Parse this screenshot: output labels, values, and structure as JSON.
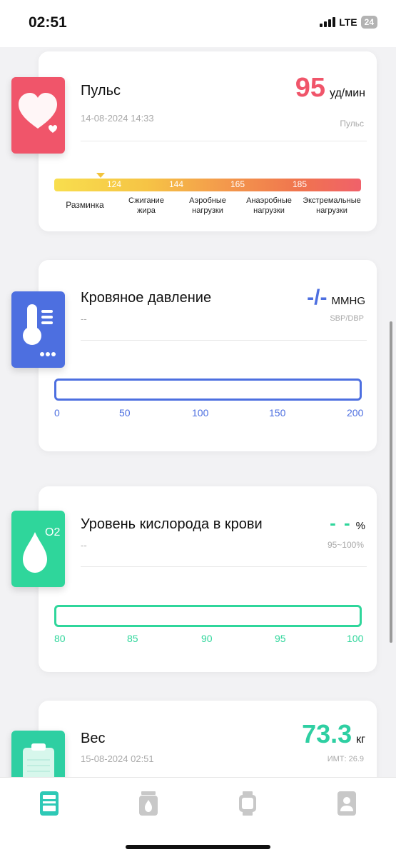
{
  "status": {
    "time": "02:51",
    "network": "LTE",
    "battery": "24"
  },
  "pulse": {
    "title": "Пульс",
    "date": "14-08-2024 14:33",
    "value": "95",
    "unit": "уд/мин",
    "sub": "Пульс",
    "color": "#f0556a",
    "ticks": [
      "124",
      "144",
      "165",
      "185"
    ],
    "zones": [
      "Разминка",
      "Сжигание\nжира",
      "Аэробные\nнагрузки",
      "Анаэробные\nнагрузки",
      "Экстремальные\nнагрузки"
    ],
    "marker_value": 95,
    "icon": "heart-icon"
  },
  "pressure": {
    "title": "Кровяное давление",
    "date": "--",
    "value": "-/-",
    "unit": "MMHG",
    "sub": "SBP/DBP",
    "color": "#4d6fe0",
    "scale": [
      "0",
      "50",
      "100",
      "150",
      "200"
    ],
    "icon": "thermometer-icon"
  },
  "oxygen": {
    "title": "Уровень кислорода в крови",
    "date": "--",
    "value": "- -",
    "unit": "%",
    "sub": "95~100%",
    "color": "#2fd69b",
    "icon_label": "O2",
    "scale": [
      "80",
      "85",
      "90",
      "95",
      "100"
    ],
    "icon": "water-drop-icon"
  },
  "weight": {
    "title": "Вес",
    "date": "15-08-2024 02:51",
    "value": "73.3",
    "unit": "кг",
    "sub": "ИМТ: 26.9",
    "color": "#2ecfa2",
    "icon": "clipboard-icon"
  },
  "tabs": [
    {
      "name": "health-tab",
      "icon": "dashboard-icon",
      "active": true
    },
    {
      "name": "activity-tab",
      "icon": "flame-icon",
      "active": false
    },
    {
      "name": "device-tab",
      "icon": "watch-icon",
      "active": false
    },
    {
      "name": "profile-tab",
      "icon": "user-icon",
      "active": false
    }
  ],
  "colors": {
    "active_tab": "#2ec9b6",
    "inactive_tab": "#c8c8c8"
  }
}
